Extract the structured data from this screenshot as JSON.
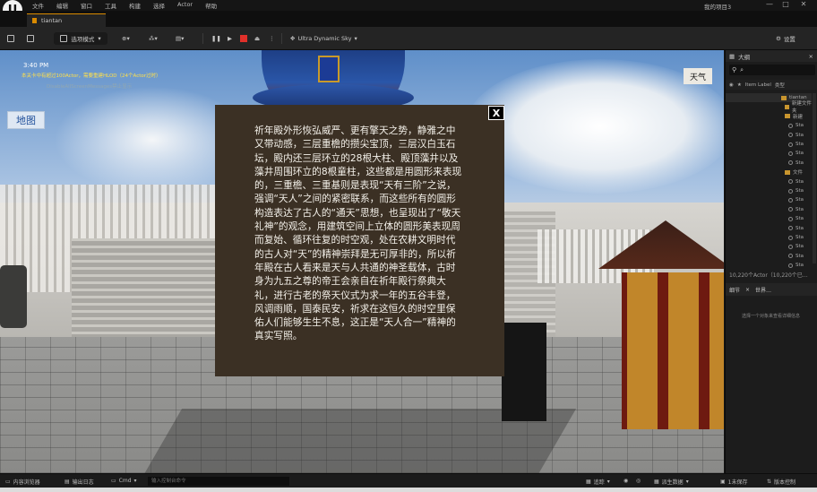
{
  "menu": {
    "logo": "U",
    "items": [
      "文件",
      "编辑",
      "窗口",
      "工具",
      "构建",
      "选择",
      "Actor",
      "帮助"
    ],
    "project_name": "我的项目3",
    "window_controls": [
      "—",
      "□",
      "✕"
    ]
  },
  "tab": {
    "label": "tiantan"
  },
  "toolbar": {
    "mode_label": "选项模式",
    "sky_label": "Ultra Dynamic Sky",
    "settings_label": "设置"
  },
  "viewport": {
    "time": "3:40 PM",
    "warning": "本关卡中有超过100Actor，需要重建HLOD（24个Actor过时）",
    "sub_warning": "DisableAllScreenMessages禁止显示",
    "map_button": "地图",
    "weather_button": "天气"
  },
  "dialog": {
    "close_label": "X",
    "text": "祈年殿外形恢弘威严、更有擎天之势，静雅之中又带动感，三层重檐的攒尖宝顶，三层汉白玉石坛，殿内还三层环立的28根大柱、殿顶藻井以及藻井周围环立的8根童柱，这些都是用圆形来表现的，三重檐、三重基则是表现“天有三阶”之说，强调“天人”之间的紧密联系，而这些所有的圆形构造表达了古人的“通天”思想，也呈现出了“敬天礼神”的观念，用建筑空间上立体的圆形美表现周而复始、循环往复的时空观，处在农耕文明时代的古人对“天”的精神崇拜是无可厚非的，所以祈年殿在古人看来是天与人共通的神圣载体，古时身为九五之尊的帝王会亲自在祈年殿行祭典大礼，进行古老的祭天仪式为求一年的五谷丰登，风调雨顺，国泰民安，祈求在这恒久的时空里保佑人们能够生生不息，这正是“天人合一”精神的真实写照。"
  },
  "outliner": {
    "title": "大纲",
    "column_label": "Item Label",
    "column_type": "类型",
    "rows": [
      {
        "label": "tiantan",
        "kind": "world"
      },
      {
        "label": "新建文件夹",
        "kind": "folder"
      },
      {
        "label": "新建",
        "kind": "folder"
      },
      {
        "label": "Sta",
        "kind": "actor"
      },
      {
        "label": "Sta",
        "kind": "actor"
      },
      {
        "label": "Sta",
        "kind": "actor"
      },
      {
        "label": "Sta",
        "kind": "actor"
      },
      {
        "label": "Sta",
        "kind": "actor"
      },
      {
        "label": "文件",
        "kind": "folder"
      },
      {
        "label": "Sta",
        "kind": "actor"
      },
      {
        "label": "Sta",
        "kind": "actor"
      },
      {
        "label": "Sta",
        "kind": "actor"
      },
      {
        "label": "Sta",
        "kind": "actor"
      },
      {
        "label": "Sta",
        "kind": "actor"
      },
      {
        "label": "Sta",
        "kind": "actor"
      },
      {
        "label": "Sta",
        "kind": "actor"
      },
      {
        "label": "Sta",
        "kind": "actor"
      },
      {
        "label": "Sta",
        "kind": "actor"
      },
      {
        "label": "Sta",
        "kind": "actor"
      }
    ],
    "actor_count": "10,220个Actor（10,220个已…"
  },
  "details": {
    "tab_details": "细节",
    "tab_world": "世界…",
    "hint": "选择一个对象来查看详细信息"
  },
  "statusbar": {
    "content_drawer": "内容浏览器",
    "output_log": "输出日志",
    "cmd_label": "Cmd",
    "cmd_placeholder": "输入控制台命令",
    "trace": "追踪",
    "derived_data": "派生数据",
    "unsaved": "1未保存",
    "source_control": "版本控制"
  }
}
